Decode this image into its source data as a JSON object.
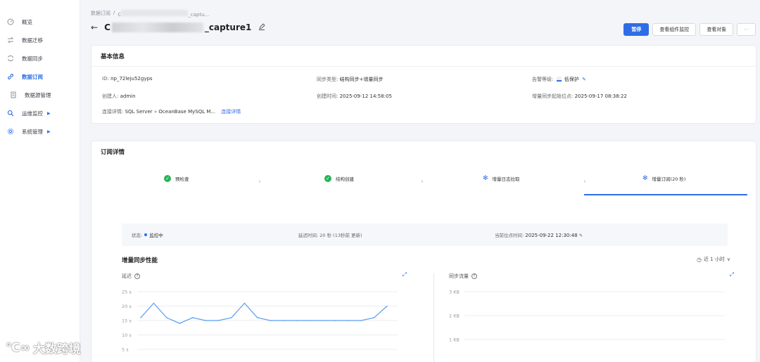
{
  "sidebar": {
    "items": [
      {
        "label": "概览",
        "icon": "dashboard-icon"
      },
      {
        "label": "数据迁移",
        "icon": "migrate-icon"
      },
      {
        "label": "数据同步",
        "icon": "sync-icon"
      },
      {
        "label": "数据订阅",
        "icon": "link-icon",
        "active": true
      },
      {
        "label": "数据源管理",
        "icon": "database-icon"
      },
      {
        "label": "运维监控",
        "icon": "search-icon"
      },
      {
        "label": "系统管理",
        "icon": "gear-icon"
      }
    ]
  },
  "header": {
    "breadcrumb_parent": "数据订阅",
    "breadcrumb_sep": "/",
    "breadcrumb_current_prefix": "C",
    "breadcrumb_current_suffix": "_captu...",
    "title_prefix": "C",
    "title_suffix": "_capture1",
    "actions": {
      "pause": "暂停",
      "view_component_monitor": "查看组件监控",
      "view_objects": "查看对象",
      "more": "···"
    }
  },
  "basic_info": {
    "title": "基本信息",
    "id_label": "ID:",
    "id_value": "np_72leju52gyps",
    "sync_type_label": "同步类型:",
    "sync_type_value": "结构同步+增量同步",
    "alert_level_label": "告警等级:",
    "alert_level_value": "低保护",
    "creator_label": "创建人:",
    "creator_value": "admin",
    "created_time_label": "创建时间:",
    "created_time_value": "2025-09-12 14:58:05",
    "incr_start_label": "增量同步起始位点:",
    "incr_start_value": "2025-09-17 08:38:22",
    "connection_label": "连接详情:",
    "connection_source": "SQL Server",
    "connection_arrow": "»",
    "connection_target": "OceanBase MySQL M...",
    "connection_link": "连接详情"
  },
  "subscription_detail": {
    "title": "订阅详情",
    "steps": [
      {
        "label": "预检查",
        "state": "done"
      },
      {
        "label": "结构创建",
        "state": "done"
      },
      {
        "label": "增量日志拉取",
        "state": "running"
      },
      {
        "label": "增量订阅(20 秒)",
        "state": "running"
      }
    ],
    "status_label": "状态:",
    "status_value": "监控中",
    "latency_label": "延迟时间:",
    "latency_value": "20 秒 (13秒前 更新)",
    "current_pos_label": "当前位点时间:",
    "current_pos_value": "2025-09-22 12:30:48",
    "perf_title": "增量同步性能",
    "time_range": "近 1 小时"
  },
  "chart_data": [
    {
      "type": "line",
      "title": "延迟",
      "ylabel": "",
      "ylim": [
        0,
        25
      ],
      "yticks": [
        "25 s",
        "20 s",
        "15 s",
        "10 s",
        "5 s"
      ],
      "series": [
        {
          "values": [
            16,
            21,
            16,
            14,
            16,
            15,
            15,
            16,
            21,
            16,
            15,
            15,
            15,
            15,
            15,
            15,
            15,
            15,
            16,
            20
          ]
        }
      ],
      "grid": true,
      "color": "#5b9cf0"
    },
    {
      "type": "line",
      "title": "同步流量",
      "ylabel": "",
      "ylim": [
        0,
        3
      ],
      "yticks": [
        "3 KB",
        "2 KB",
        "1 KB"
      ],
      "series": [],
      "grid": true
    }
  ],
  "watermark": "大数跨境",
  "colors": {
    "accent": "#2f6de6",
    "success": "#27b35b",
    "line": "#5b9cf0"
  }
}
